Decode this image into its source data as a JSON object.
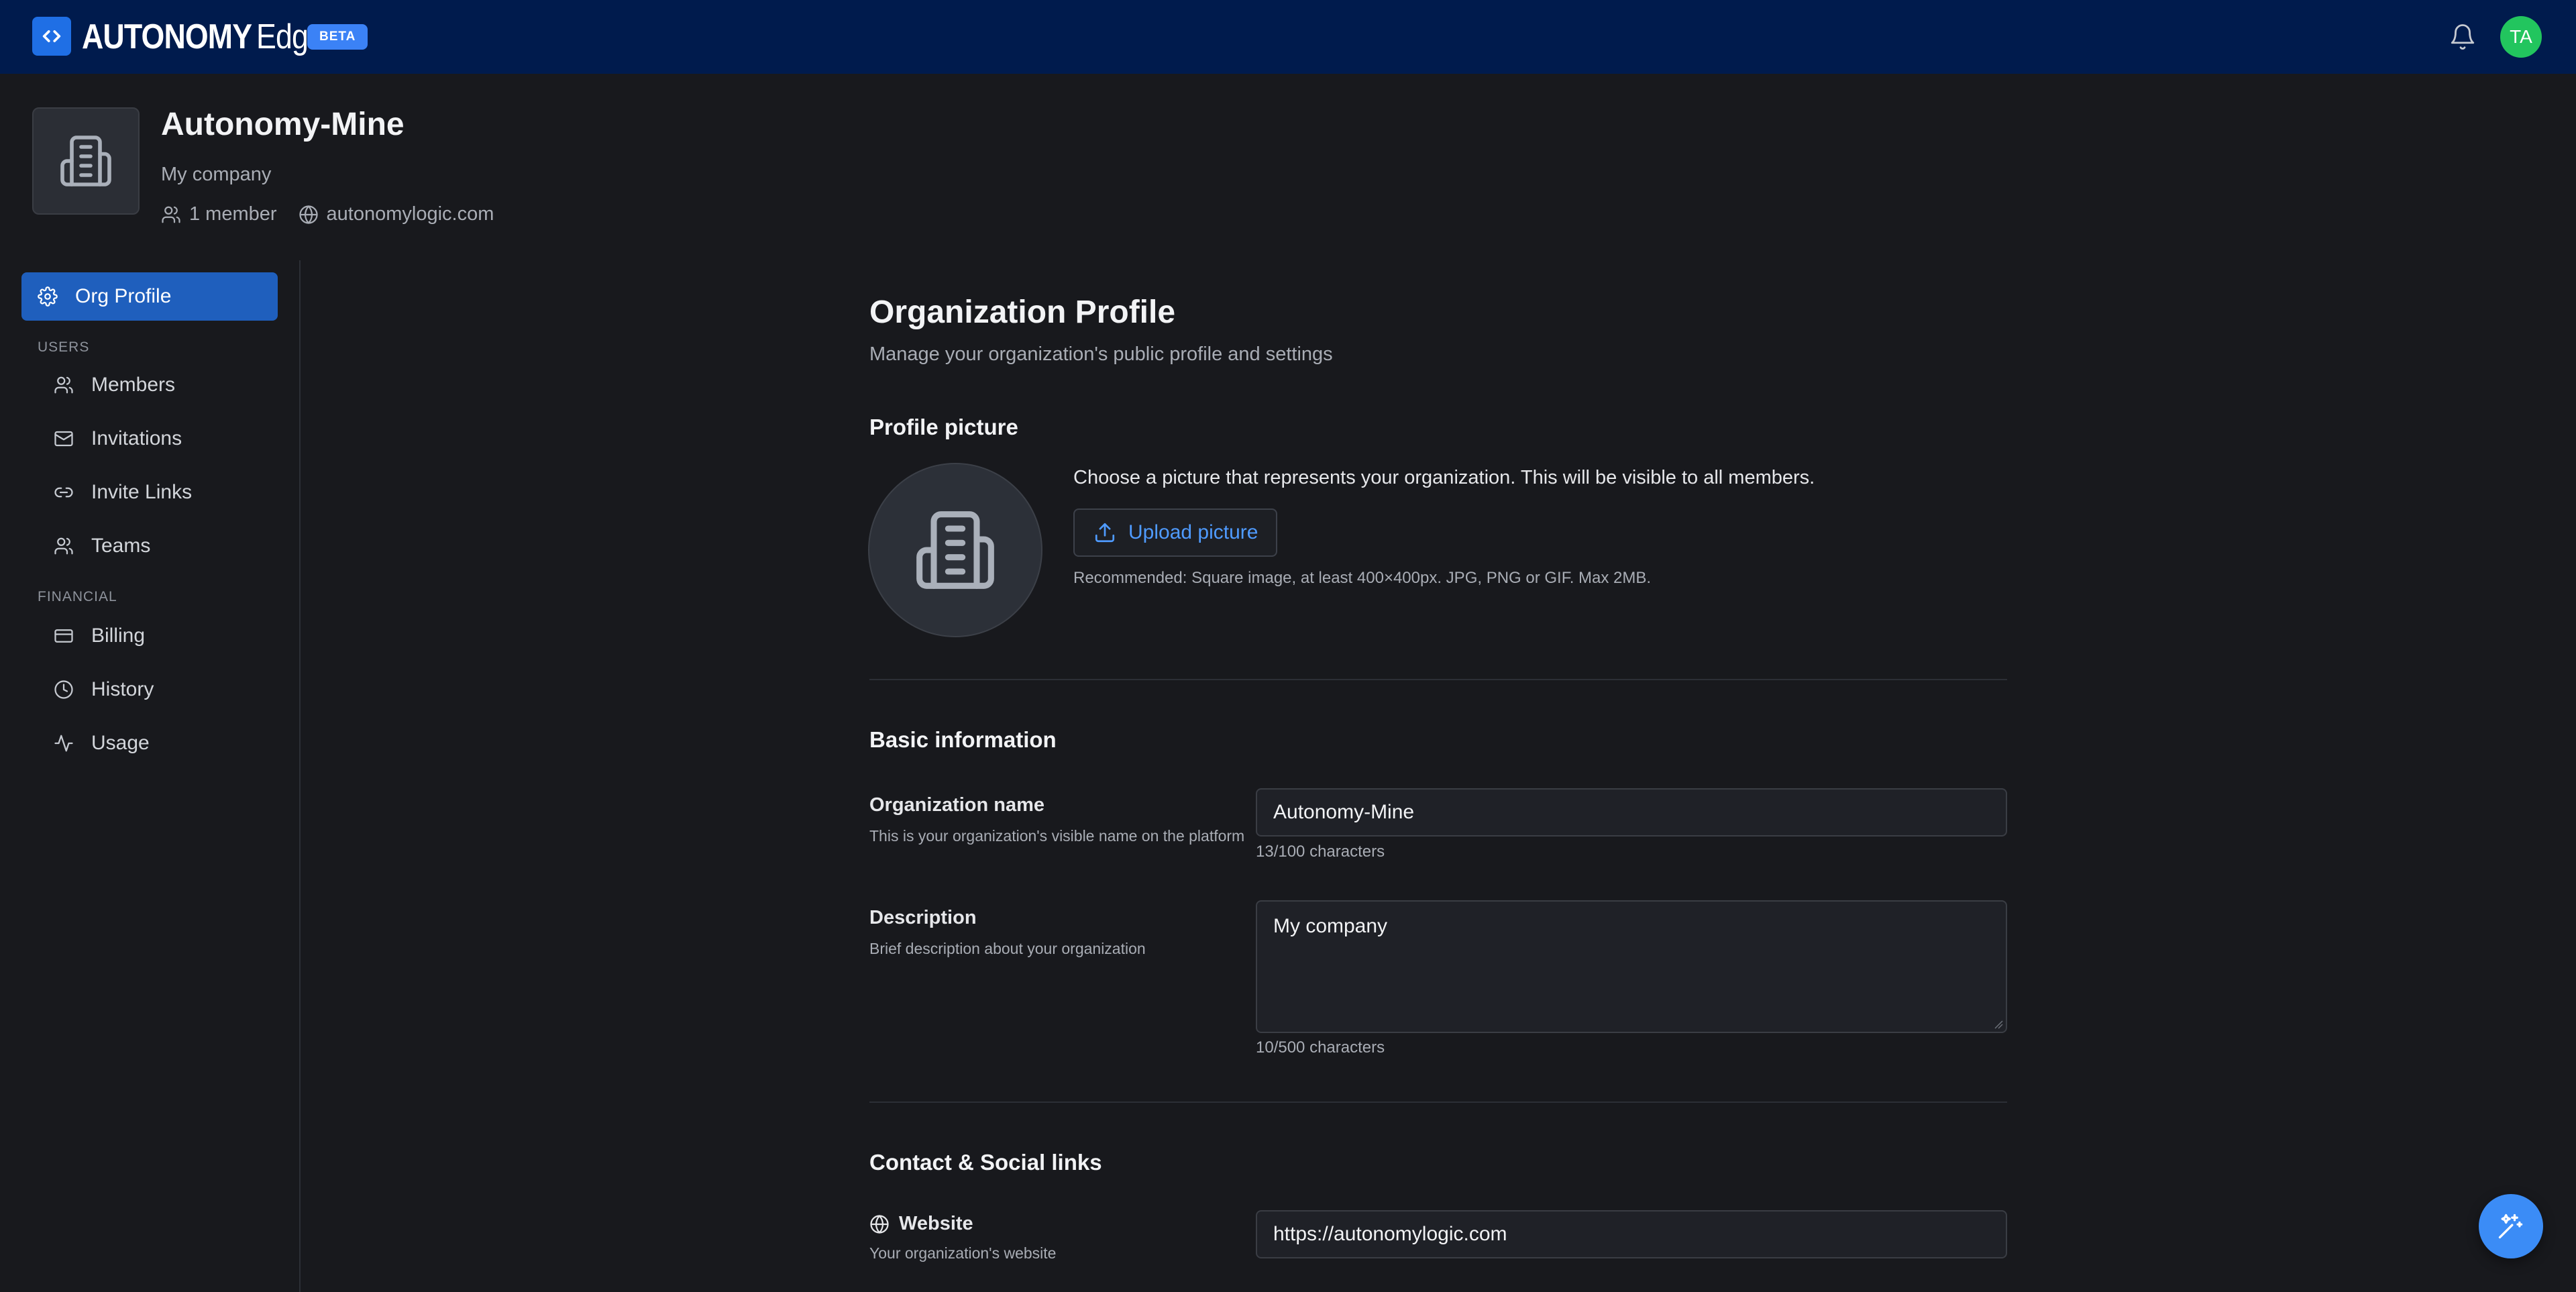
{
  "app": {
    "brand_bold": "AUTONOMY",
    "brand_light": "Edge",
    "badge": "BETA",
    "user_initials": "TA"
  },
  "org": {
    "name": "Autonomy-Mine",
    "description": "My company",
    "members": "1 member",
    "domain": "autonomylogic.com"
  },
  "sidebar": {
    "active": "Org Profile",
    "sections": [
      {
        "title": "USERS",
        "items": [
          "Members",
          "Invitations",
          "Invite Links",
          "Teams"
        ]
      },
      {
        "title": "FINANCIAL",
        "items": [
          "Billing",
          "History",
          "Usage"
        ]
      }
    ]
  },
  "page": {
    "title": "Organization Profile",
    "subtitle": "Manage your organization's public profile and settings",
    "profile_picture": {
      "title": "Profile picture",
      "text": "Choose a picture that represents your organization. This will be visible to all members.",
      "button": "Upload picture",
      "recommendation": "Recommended: Square image, at least 400×400px. JPG, PNG or GIF. Max 2MB."
    },
    "basic": {
      "title": "Basic information",
      "name_label": "Organization name",
      "name_help": "This is your organization's visible name on the platform",
      "name_value": "Autonomy-Mine",
      "name_count": "13/100 characters",
      "desc_label": "Description",
      "desc_help": "Brief description about your organization",
      "desc_value": "My company",
      "desc_count": "10/500 characters"
    },
    "contact": {
      "title": "Contact & Social links",
      "website_label": "Website",
      "website_help": "Your organization's website",
      "website_value": "https://autonomylogic.com"
    }
  },
  "colors": {
    "topbar": "#001b4d",
    "accent": "#1f6fe5",
    "active_nav": "#1f5fbd",
    "avatar": "#22c55e",
    "link": "#4f9bff"
  }
}
